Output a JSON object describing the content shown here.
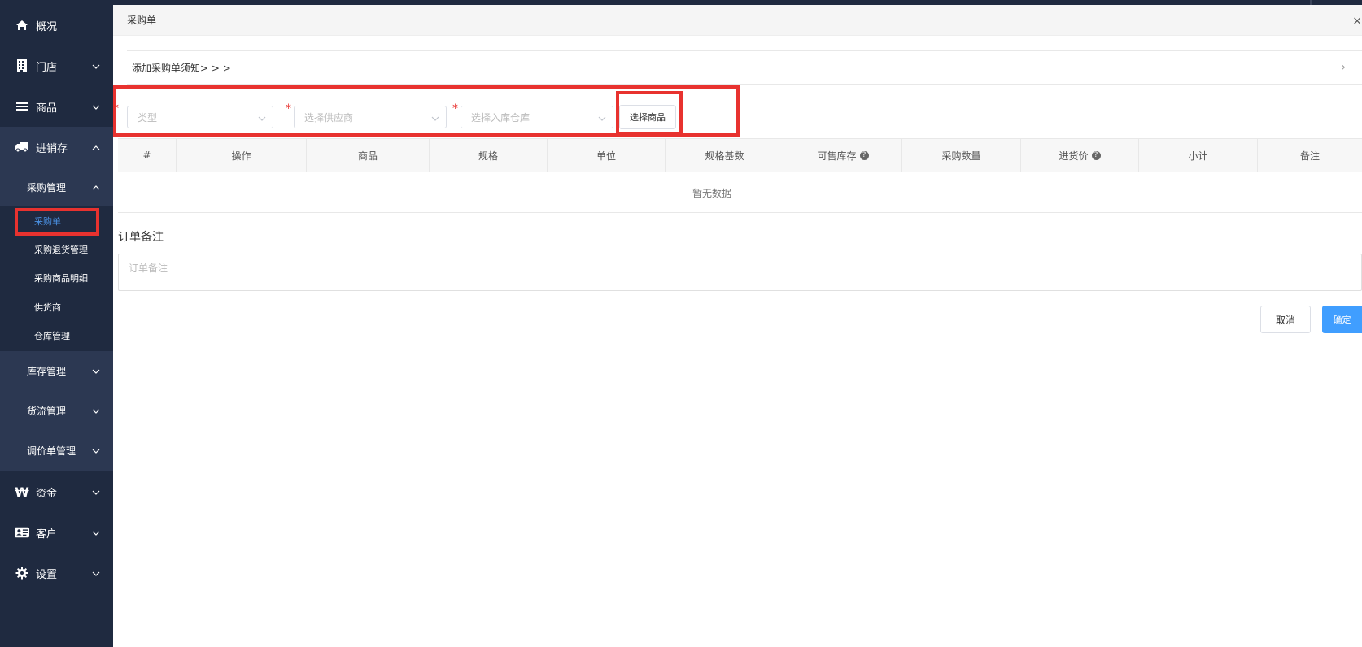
{
  "sidebar": {
    "top_items": [
      {
        "label": "概况",
        "icon": "home-icon"
      },
      {
        "label": "门店",
        "icon": "building-icon"
      },
      {
        "label": "商品",
        "icon": "list-icon"
      },
      {
        "label": "进销存",
        "icon": "truck-icon"
      },
      {
        "label": "资金",
        "icon": "won-icon"
      },
      {
        "label": "客户",
        "icon": "id-card-icon"
      },
      {
        "label": "设置",
        "icon": "gear-icon"
      }
    ],
    "sub_menus": [
      {
        "label": "采购管理"
      },
      {
        "label": "库存管理"
      },
      {
        "label": "货流管理"
      },
      {
        "label": "调价单管理"
      }
    ],
    "purchase_items": [
      {
        "label": "采购单",
        "active": true
      },
      {
        "label": "采购退货管理"
      },
      {
        "label": "采购商品明细"
      },
      {
        "label": "供货商"
      },
      {
        "label": "仓库管理"
      }
    ]
  },
  "modal": {
    "title": "采购单",
    "close": "×",
    "notice": "添加采购单须知> > >",
    "notice_arrow": "›",
    "required_mark": "*",
    "form": {
      "type_placeholder": "类型",
      "supplier_placeholder": "选择供应商",
      "warehouse_placeholder": "选择入库仓库",
      "select_goods_label": "选择商品"
    },
    "table": {
      "columns": [
        "#",
        "操作",
        "商品",
        "规格",
        "单位",
        "规格基数",
        "可售库存",
        "采购数量",
        "进货价",
        "小计",
        "备注"
      ],
      "help_icon": "?",
      "empty_text": "暂无数据"
    },
    "remark_title": "订单备注",
    "remark_placeholder": "订单备注",
    "cancel_label": "取消",
    "ok_label": "确定"
  },
  "colors": {
    "sidebar_bg": "#1f2a40",
    "submenu_bg": "#2c3852",
    "highlight": "#e8322f",
    "primary": "#409eff",
    "active_link": "#4a90e2"
  }
}
